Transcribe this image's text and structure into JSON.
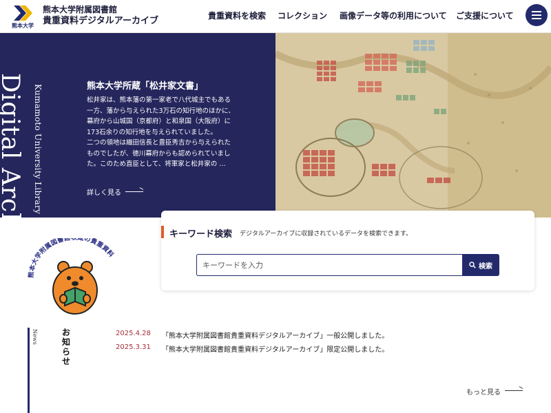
{
  "header": {
    "logo_caption": "熊本大学",
    "title_line1": "熊本大学附属図書館",
    "title_line2": "貴重資料デジタルアーカイブ",
    "nav": [
      {
        "label": "貴重資料を検索"
      },
      {
        "label": "コレクション"
      },
      {
        "label": "画像データ等の利用について"
      },
      {
        "label": "ご支援について"
      }
    ],
    "menu_icon": "hamburger-icon"
  },
  "hero": {
    "vertical_title": "Digital Archive",
    "vertical_subtitle": "Kumamoto University Library",
    "heading": "熊本大学所蔵「松井家文書」",
    "body_lines": [
      "松井家は、熊本藩の第一家老で八代城主でもある一方、藩から与えられた3万石の知行地のほかに、幕府から山城国（京都府）と和泉国（大阪府）に173石余りの知行地を与えられていました。",
      "二つの領地は織田信長と豊臣秀吉から与えられたものでしたが、徳川幕府からも認められていました。このため直臣として、将軍家と松井家の …"
    ],
    "more_label": "詳しく見る",
    "colors": {
      "panel": "#25265c",
      "map_paper": "#d8c8a2"
    }
  },
  "search": {
    "title": "キーワード検索",
    "description": "デジタルアーカイブに収録されているデータを検索できます。",
    "placeholder": "キーワードを入力",
    "value": "",
    "button_label": "検索",
    "button_icon": "search-icon",
    "accent_color": "#e25a2a"
  },
  "mascot": {
    "arc_text": "熊本大学附属図書館収蔵の貴重資料",
    "icon": "bear-reading-book-icon"
  },
  "news": {
    "label_en": "News",
    "label_jp": "お知らせ",
    "items": [
      {
        "date": "2025.4.28",
        "text": "「熊本大学附属図書館貴重資料デジタルアーカイブ」一般公開しました。"
      },
      {
        "date": "2025.3.31",
        "text": "「熊本大学附属図書館貴重資料デジタルアーカイブ」限定公開しました。"
      }
    ],
    "more_label": "もっと見る"
  }
}
